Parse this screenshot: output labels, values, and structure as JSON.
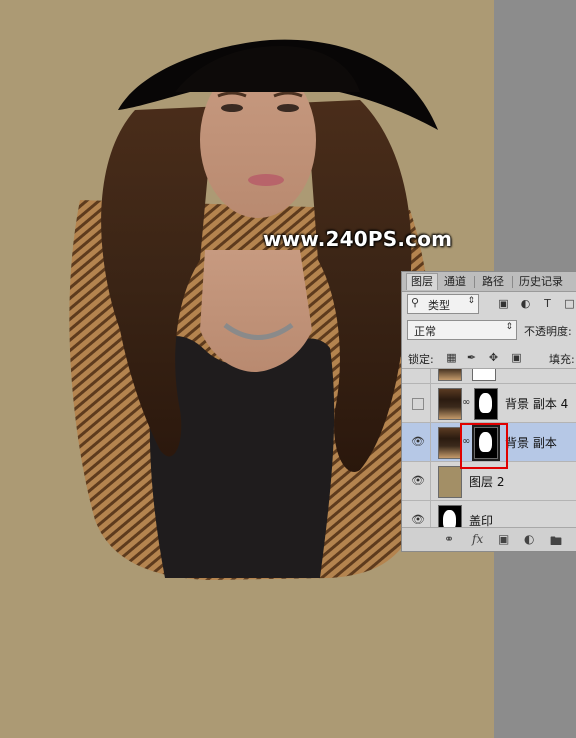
{
  "watermark": {
    "text": "www.240PS.com"
  },
  "colors": {
    "background": "#ac9a74",
    "panel": "#d6d6d6",
    "selected_layer": "#b6c8e6",
    "highlight": "#e00000"
  },
  "layers_panel": {
    "tabs": [
      "图层",
      "通道",
      "路径",
      "历史记录"
    ],
    "filter": {
      "icon": "search-icon",
      "label": "类型"
    },
    "blend_mode": "正常",
    "opacity_label": "不透明度:",
    "lock_label": "锁定:",
    "fill_label": "填充:",
    "layers": [
      {
        "name": "",
        "visible": true,
        "state": "partial-top"
      },
      {
        "name": "背景 副本 4",
        "visible": false,
        "has_mask": true
      },
      {
        "name": "背景 副本",
        "visible": true,
        "has_mask": true,
        "selected": true
      },
      {
        "name": "图层 2",
        "visible": true,
        "has_mask": false
      },
      {
        "name": "盖印",
        "visible": true,
        "state": "partial-bottom"
      }
    ],
    "bottom_icons": [
      "link-icon",
      "fx-icon",
      "add-mask-icon",
      "adjustment-icon",
      "folder-icon"
    ]
  }
}
